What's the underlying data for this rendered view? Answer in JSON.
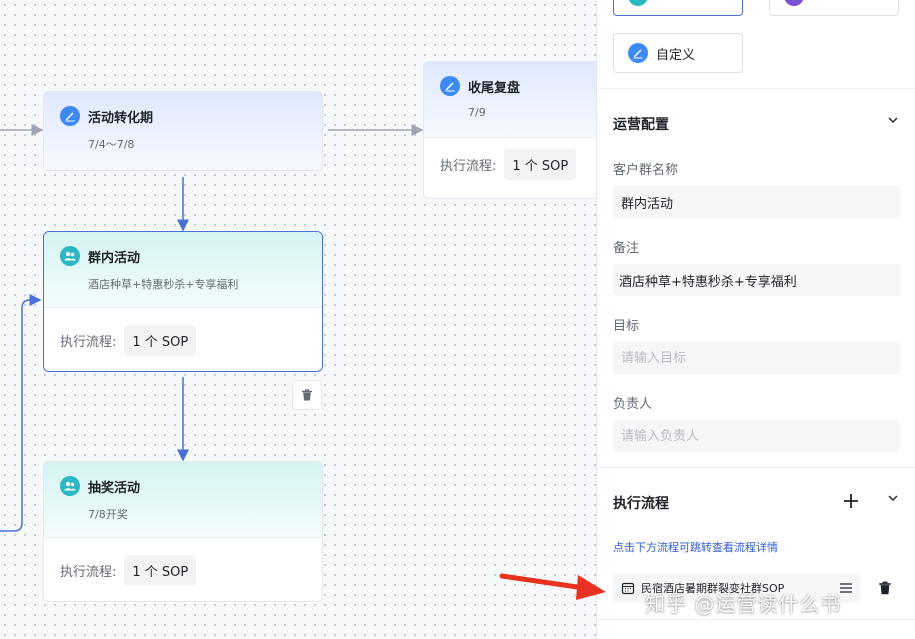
{
  "nodes": {
    "conversion": {
      "title": "活动转化期",
      "subtitle": "7/4～7/8"
    },
    "review": {
      "title": "收尾复盘",
      "subtitle": "7/9",
      "flow_label": "执行流程:",
      "sop": "1 个 SOP"
    },
    "group": {
      "title": "群内活动",
      "subtitle": "酒店种草+特惠秒杀+专享福利",
      "flow_label": "执行流程:",
      "sop": "1 个 SOP"
    },
    "lottery": {
      "title": "抽奖活动",
      "subtitle": "7/8开奖",
      "flow_label": "执行流程:",
      "sop": "1 个 SOP"
    }
  },
  "panel": {
    "templates": {
      "custom_label": "自定义"
    },
    "ops_config": {
      "title": "运营配置",
      "group_name_label": "客户群名称",
      "group_name_value": "群内活动",
      "remark_label": "备注",
      "remark_value": "酒店种草+特惠秒杀+专享福利",
      "goal_label": "目标",
      "goal_placeholder": "请输入目标",
      "owner_label": "负责人",
      "owner_placeholder": "请输入负责人"
    },
    "exec_flow": {
      "title": "执行流程",
      "hint": "点击下方流程可跳转查看流程详情",
      "item": "民宿酒店暑期群裂变社群SOP"
    }
  },
  "watermark": "知乎 @运营读什么书",
  "colors": {
    "accent": "#4a6fd6",
    "link": "#2f5cd6",
    "arrow": "#e8321f"
  },
  "icons": [
    "edit-icon",
    "group-icon",
    "trash-icon",
    "chevron-down-icon",
    "plus-icon",
    "list-icon",
    "calendar-icon"
  ]
}
